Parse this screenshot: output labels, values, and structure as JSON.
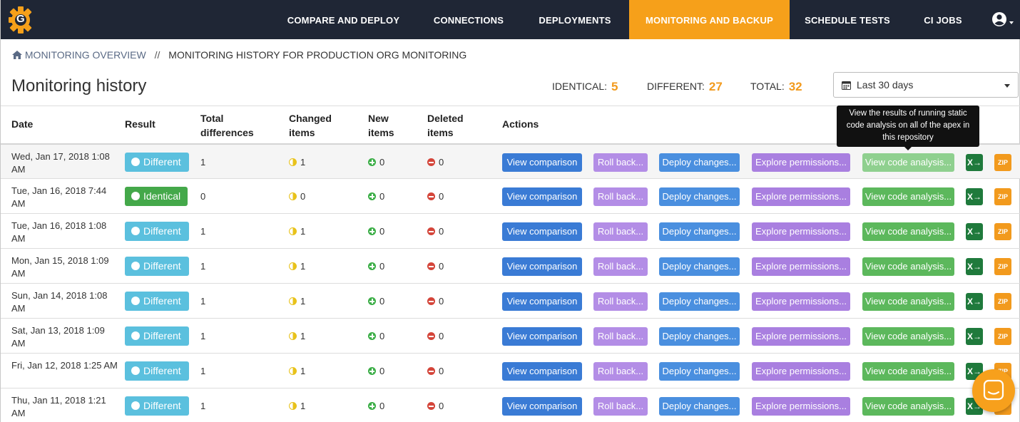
{
  "nav": {
    "items": [
      {
        "label": "COMPARE AND DEPLOY",
        "active": false
      },
      {
        "label": "CONNECTIONS",
        "active": false
      },
      {
        "label": "DEPLOYMENTS",
        "active": false
      },
      {
        "label": "MONITORING AND BACKUP",
        "active": true
      },
      {
        "label": "SCHEDULE TESTS",
        "active": false
      },
      {
        "label": "CI JOBS",
        "active": false
      }
    ],
    "logo_letter": "G",
    "logo_icon": "gearset-gear-logo",
    "user_icon": "user-circle-icon"
  },
  "breadcrumb": {
    "link": "MONITORING OVERVIEW",
    "separator": "//",
    "current": "MONITORING HISTORY FOR PRODUCTION ORG MONITORING"
  },
  "page": {
    "title": "Monitoring history",
    "stats": {
      "identical_label": "IDENTICAL:",
      "identical_value": "5",
      "different_label": "DIFFERENT:",
      "different_value": "27",
      "total_label": "TOTAL:",
      "total_value": "32"
    },
    "date_range": "Last 30 days"
  },
  "table": {
    "headers": {
      "date": "Date",
      "result": "Result",
      "total_1": "Total",
      "total_2": "differences",
      "changed_1": "Changed",
      "changed_2": "items",
      "new_1": "New",
      "new_2": "items",
      "deleted_1": "Deleted",
      "deleted_2": "items",
      "actions": "Actions"
    },
    "actions": {
      "view": "View comparison",
      "rollback": "Roll back...",
      "deploy": "Deploy changes...",
      "permissions": "Explore permissions...",
      "code": "View code analysis...",
      "excel": "X→",
      "zip": "ZIP"
    },
    "rows": [
      {
        "date": "Wed, Jan 17, 2018 1:08 AM",
        "result": "Different",
        "total": "1",
        "changed": "1",
        "new": "0",
        "deleted": "0"
      },
      {
        "date": "Tue, Jan 16, 2018 7:44 AM",
        "result": "Identical",
        "total": "0",
        "changed": "0",
        "new": "0",
        "deleted": "0"
      },
      {
        "date": "Tue, Jan 16, 2018 1:08 AM",
        "result": "Different",
        "total": "1",
        "changed": "1",
        "new": "0",
        "deleted": "0"
      },
      {
        "date": "Mon, Jan 15, 2018 1:09 AM",
        "result": "Different",
        "total": "1",
        "changed": "1",
        "new": "0",
        "deleted": "0"
      },
      {
        "date": "Sun, Jan 14, 2018 1:08 AM",
        "result": "Different",
        "total": "1",
        "changed": "1",
        "new": "0",
        "deleted": "0"
      },
      {
        "date": "Sat, Jan 13, 2018 1:09 AM",
        "result": "Different",
        "total": "1",
        "changed": "1",
        "new": "0",
        "deleted": "0"
      },
      {
        "date": "Fri, Jan 12, 2018 1:25 AM",
        "result": "Different",
        "total": "1",
        "changed": "1",
        "new": "0",
        "deleted": "0"
      },
      {
        "date": "Thu, Jan 11, 2018 1:21 AM",
        "result": "Different",
        "total": "1",
        "changed": "1",
        "new": "0",
        "deleted": "0"
      }
    ]
  },
  "tooltip": "View the results of running static code analysis on all of the apex in this repository",
  "colors": {
    "nav_bg": "#1f2635",
    "accent_orange": "#f6a01a",
    "different_badge": "#5bc0de",
    "identical_badge": "#44a84a"
  }
}
